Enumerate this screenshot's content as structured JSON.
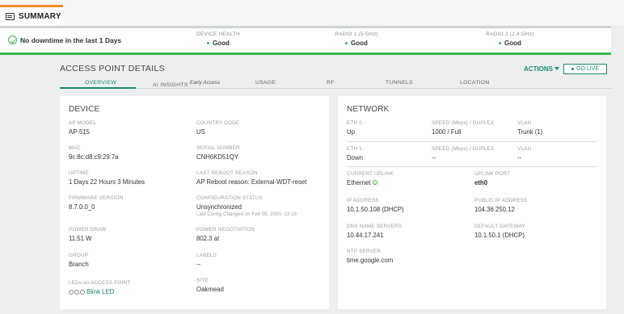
{
  "summary_tab": {
    "label": "SUMMARY"
  },
  "health": {
    "downtime": "No downtime in the last 1 Days",
    "device_health": {
      "title": "DEVICE HEALTH",
      "value": "Good"
    },
    "radio1": {
      "title": "RADIO 1 (5 GHz)",
      "value": "Good"
    },
    "radio2": {
      "title": "RADIO 2 (2.4 GHz)",
      "value": "Good"
    }
  },
  "details": {
    "title": "ACCESS POINT DETAILS",
    "actions_label": "ACTIONS",
    "golive_label": "GO LIVE",
    "tabs": [
      {
        "label": "OVERVIEW"
      },
      {
        "label": "AI INSIGHTS",
        "sup": "Early Access"
      },
      {
        "label": "USAGE"
      },
      {
        "label": "RF"
      },
      {
        "label": "TUNNELS"
      },
      {
        "label": "LOCATION"
      }
    ]
  },
  "device": {
    "title": "DEVICE",
    "ap_model": {
      "label": "AP MODEL",
      "value": "AP-515"
    },
    "country_code": {
      "label": "COUNTRY CODE",
      "value": "US"
    },
    "mac": {
      "label": "MAC",
      "value": "9c:8c:d8:c9:29:7a"
    },
    "serial": {
      "label": "SERIAL NUMBER",
      "value": "CNH6KD51QY"
    },
    "uptime": {
      "label": "UPTIME",
      "value": "1 Days 22 Hours 3 Minutes"
    },
    "last_reboot": {
      "label": "LAST REBOOT REASON",
      "value": "AP Reboot reason: External-WDT-reset"
    },
    "firmware": {
      "label": "FIRMWARE VERSION",
      "value": "8.7.0.0_0"
    },
    "config_status": {
      "label": "CONFIGURATION STATUS",
      "value": "Unsynchronized",
      "sub": "Last Config Changed on Feb 05, 2020, 23:19"
    },
    "power_draw": {
      "label": "POWER DRAW",
      "value": "11.51 W"
    },
    "power_negotiation": {
      "label": "POWER NEGOTIATION",
      "value": "802.3 at"
    },
    "group": {
      "label": "GROUP",
      "value": "Branch"
    },
    "labels": {
      "label": "LABELS",
      "value": "--"
    },
    "leds": {
      "label": "LEDs on ACCESS POINT",
      "value": "Blink LED"
    },
    "site": {
      "label": "SITE",
      "value": "Oakmead"
    }
  },
  "network": {
    "title": "NETWORK",
    "eth0": {
      "label": "ETH 0",
      "value": "Up"
    },
    "eth0_speed": {
      "label": "SPEED (Mbps) / DUPLEX",
      "value": "1000 / Full"
    },
    "eth0_vlan": {
      "label": "VLAN",
      "value": "Trunk (1)"
    },
    "eth1": {
      "label": "ETH 1",
      "value": "Down"
    },
    "eth1_speed": {
      "label": "SPEED (Mbps) / DUPLEX",
      "value": "--"
    },
    "eth1_vlan": {
      "label": "VLAN",
      "value": "--"
    },
    "current_uplink": {
      "label": "CURRENT UPLINK",
      "value": "Ethernet"
    },
    "uplink_port": {
      "label": "UPLINK PORT",
      "value": "eth0"
    },
    "ip": {
      "label": "IP ADDRESS",
      "value": "10.1.50.108 (DHCP)"
    },
    "public_ip": {
      "label": "PUBLIC IP ADDRESS",
      "value": "104.36.250.12"
    },
    "dns": {
      "label": "DNS NAME SERVERS",
      "value": "10.44.17.241"
    },
    "gateway": {
      "label": "DEFAULT GATEWAY",
      "value": "10.1.50.1 (DHCP)"
    },
    "ntp": {
      "label": "NTP SERVER",
      "value": "time.google.com"
    }
  },
  "colors": {
    "accent": "#1c8c6e",
    "good": "#3cb54a",
    "tab_highlight": "#ee8d2c"
  }
}
